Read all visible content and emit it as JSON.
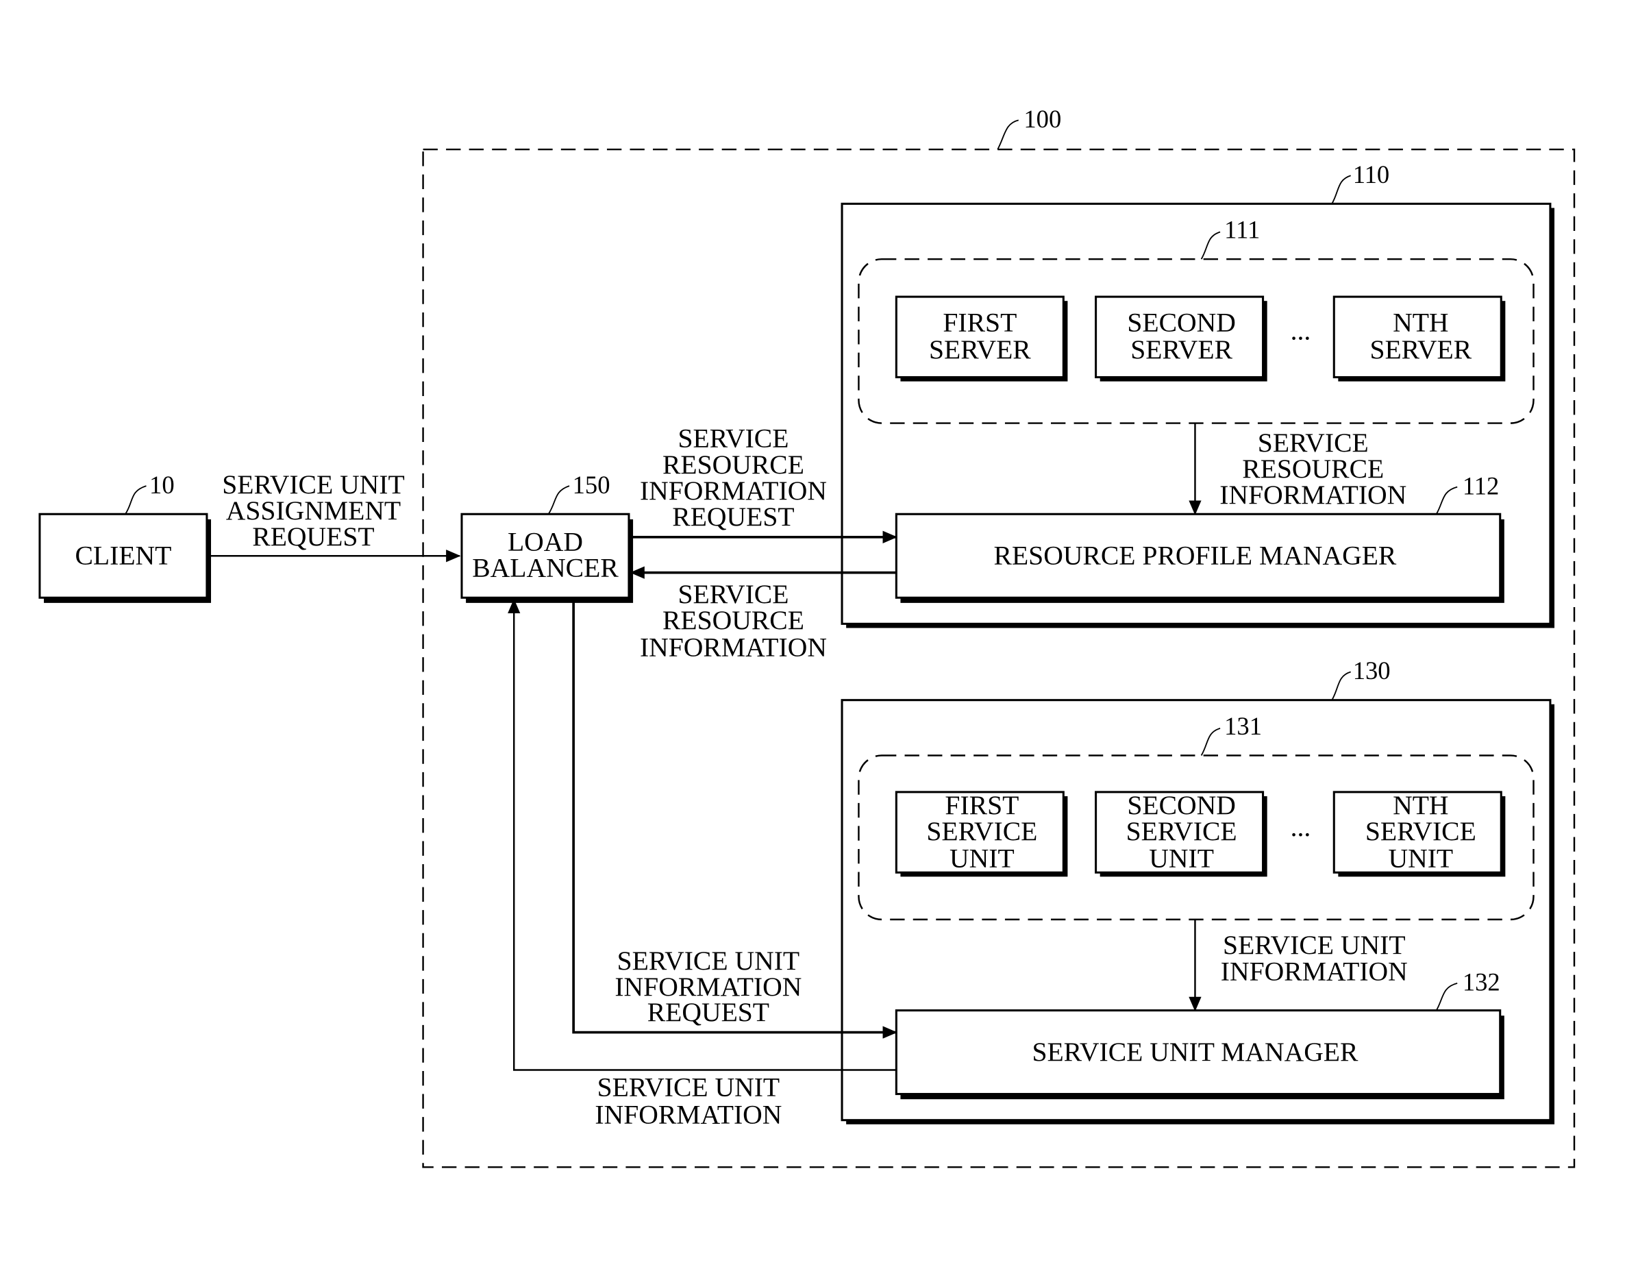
{
  "diagram": {
    "system": {
      "ref": "100"
    },
    "client": {
      "ref": "10",
      "label": [
        "CLIENT"
      ]
    },
    "load_balancer": {
      "ref": "150",
      "label": [
        "LOAD",
        "BALANCER"
      ]
    },
    "resource_module": {
      "ref": "110"
    },
    "server_group": {
      "ref": "111"
    },
    "servers": [
      {
        "label": [
          "FIRST",
          "SERVER"
        ]
      },
      {
        "label": [
          "SECOND",
          "SERVER"
        ]
      },
      {
        "label": [
          "NTH",
          "SERVER"
        ]
      }
    ],
    "resource_profile_manager": {
      "ref": "112",
      "label": "RESOURCE PROFILE MANAGER"
    },
    "service_module": {
      "ref": "130"
    },
    "service_unit_group": {
      "ref": "131"
    },
    "service_units": [
      {
        "label": [
          "FIRST",
          "SERVICE",
          "UNIT"
        ]
      },
      {
        "label": [
          "SECOND",
          "SERVICE",
          "UNIT"
        ]
      },
      {
        "label": [
          "NTH",
          "SERVICE",
          "UNIT"
        ]
      }
    ],
    "service_unit_manager": {
      "ref": "132",
      "label": "SERVICE UNIT MANAGER"
    },
    "ellipsis": "...",
    "edges": {
      "client_to_lb": [
        "SERVICE UNIT",
        "ASSIGNMENT",
        "REQUEST"
      ],
      "lb_to_rpm": [
        "SERVICE",
        "RESOURCE",
        "INFORMATION",
        "REQUEST"
      ],
      "rpm_to_lb": [
        "SERVICE",
        "RESOURCE",
        "INFORMATION"
      ],
      "servers_to_rpm": [
        "SERVICE",
        "RESOURCE",
        "INFORMATION"
      ],
      "lb_to_sum": [
        "SERVICE UNIT",
        "INFORMATION",
        "REQUEST"
      ],
      "sum_to_lb": [
        "SERVICE UNIT",
        "INFORMATION"
      ],
      "units_to_sum": [
        "SERVICE UNIT",
        "INFORMATION"
      ]
    }
  }
}
